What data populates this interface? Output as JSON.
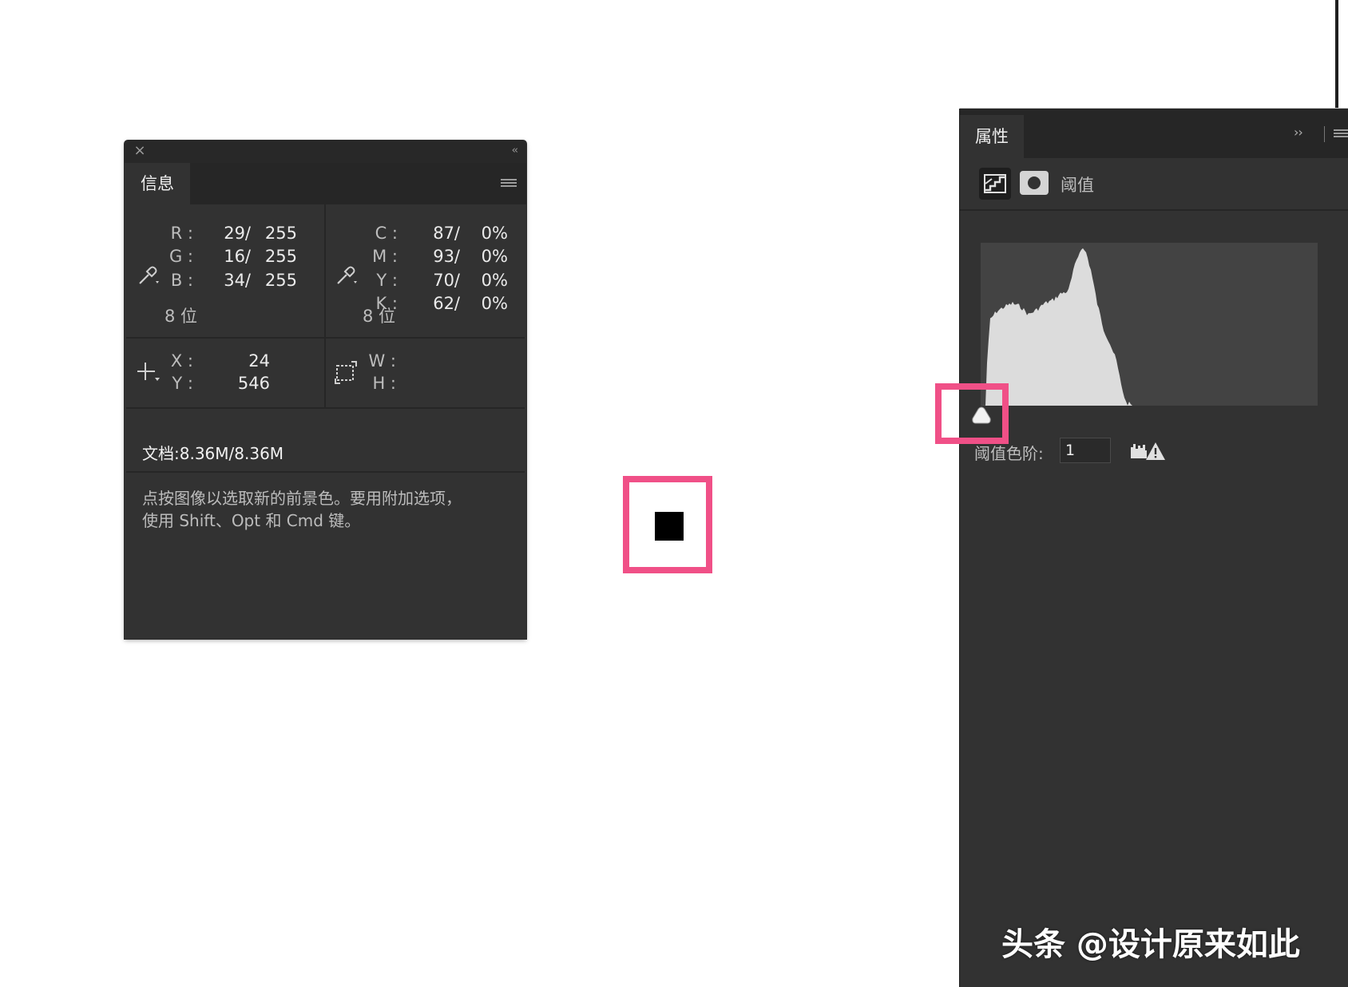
{
  "info_panel": {
    "tab_label": "信息",
    "rgb": {
      "labels": [
        "R :",
        "G :",
        "B :"
      ],
      "values": [
        "29/",
        "16/",
        "34/"
      ],
      "max": [
        "255",
        "255",
        "255"
      ],
      "bits": "8 位"
    },
    "cmyk": {
      "labels": [
        "C :",
        "M :",
        "Y :",
        "K :"
      ],
      "values": [
        "87/",
        "93/",
        "70/",
        "62/"
      ],
      "pct": [
        "0%",
        "0%",
        "0%",
        "0%"
      ],
      "bits": "8 位"
    },
    "coords": {
      "x_label": "X :",
      "y_label": "Y :",
      "x_value": "24",
      "y_value": "546",
      "w_label": "W :",
      "h_label": "H :"
    },
    "doc_size": "文档:8.36M/8.36M",
    "hint_line1": "点按图像以选取新的前景色。要用附加选项，",
    "hint_line2": "使用 Shift、Opt 和 Cmd 键。"
  },
  "properties_panel": {
    "tab_label": "属性",
    "adjustment_title": "阈值",
    "threshold_label": "阈值色阶:",
    "threshold_value": "1"
  },
  "swatch": {
    "color": "#000000"
  },
  "colors": {
    "highlight": "#f05087",
    "panel_bg": "#323232",
    "histogram_fill": "#dcdcdc",
    "histogram_bg": "#434343"
  },
  "watermark": "头条 @设计原来如此"
}
